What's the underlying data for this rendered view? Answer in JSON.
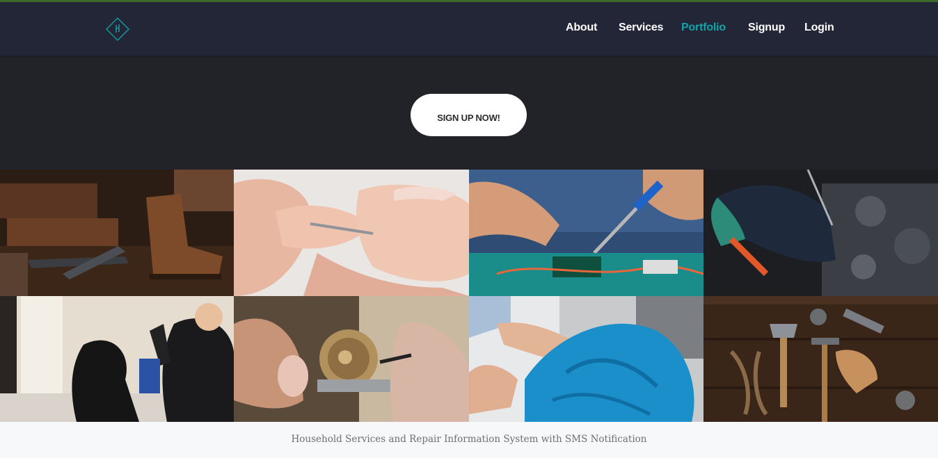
{
  "nav": {
    "logo_icon": "diamond-logo-icon",
    "links": [
      "About",
      "Services",
      "Portfolio",
      "Signup",
      "Login"
    ],
    "active_link": "Portfolio",
    "active_color": "#14a3a6"
  },
  "masthead": {
    "cta_label": "SIGN UP NOW!"
  },
  "portfolio": {
    "items": [
      "cobbler-tools-and-boot",
      "manicure-nail-care",
      "soldering-electronics-repair",
      "car-engine-repair",
      "hair-salon-styling",
      "watch-repair",
      "laundry-towel",
      "carpentry-tools"
    ]
  },
  "footer": {
    "text": "Household Services and Repair Information System with SMS Notification"
  }
}
